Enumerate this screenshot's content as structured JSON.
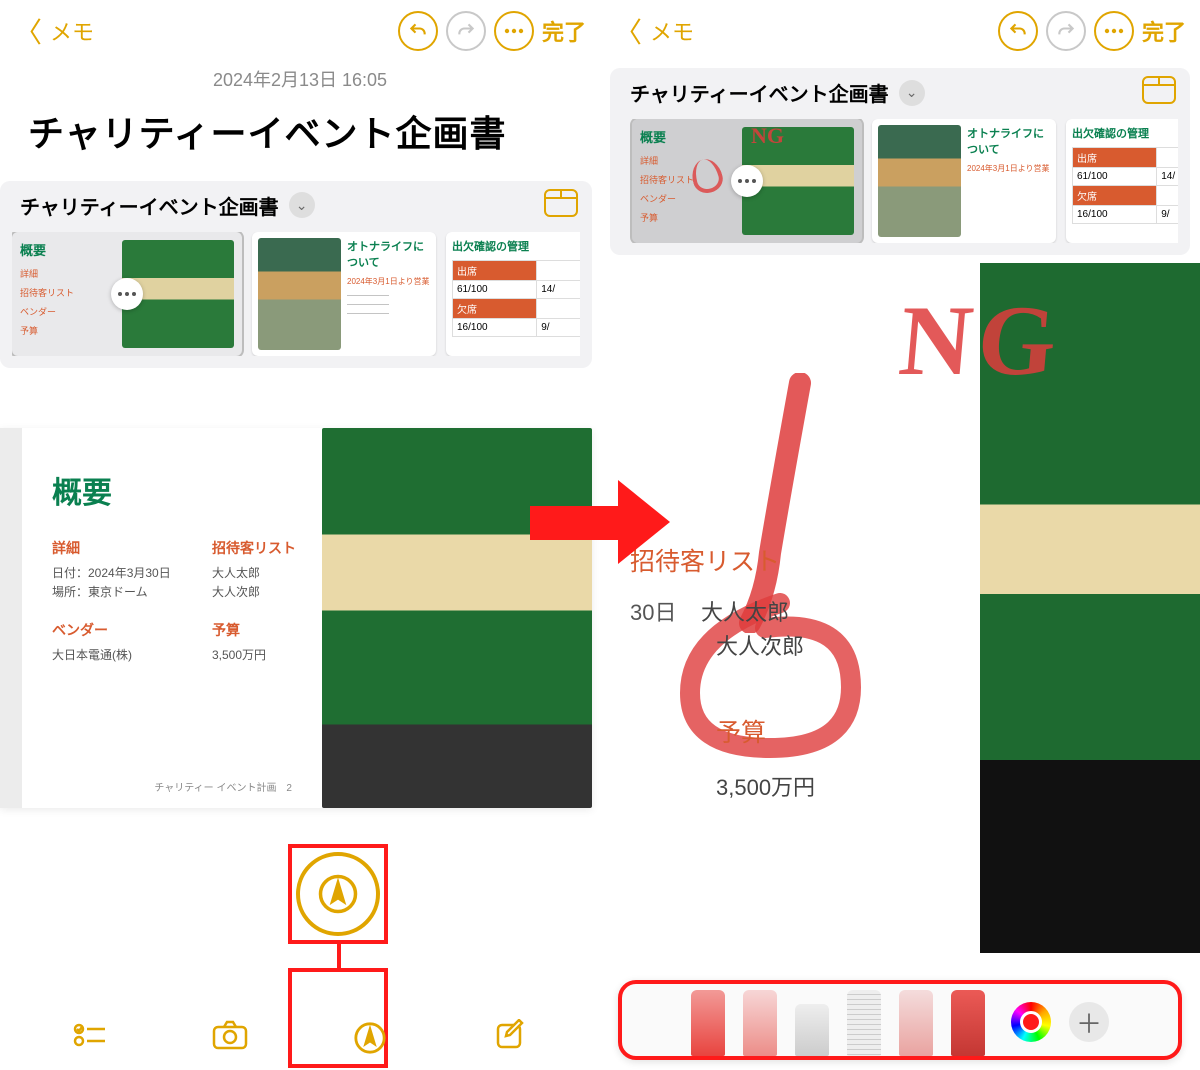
{
  "header": {
    "back_label": "メモ",
    "done_label": "完了"
  },
  "datetime": "2024年2月13日 16:05",
  "title": "チャリティーイベント企画書",
  "attachment": {
    "title": "チャリティーイベント企画書",
    "thumb1_heading": "概要",
    "thumb2_heading": "オトナライフについて",
    "thumb3_heading": "出欠確認の管理",
    "table_v1": "61/100",
    "table_v2": "14/",
    "table_v3": "16/100",
    "table_v4": "9/"
  },
  "slide": {
    "heading": "概要",
    "detail_label": "詳細",
    "detail_date": "日付：2024年3月30日",
    "detail_place": "場所：東京ドーム",
    "guests_label": "招待客リスト",
    "guest1": "大人太郎",
    "guest2": "大人次郎",
    "vendor_label": "ベンダー",
    "vendor_value": "大日本電通(株)",
    "budget_label": "予算",
    "budget_value": "3,500万円",
    "footer": "チャリティー イベント計画　2"
  },
  "zoom": {
    "date_frag": "30日",
    "guests_label": "招待客リスト",
    "guest1": "大人太郎",
    "guest2": "大人次郎",
    "budget_label": "予算",
    "budget_value": "3,500万円",
    "annotation_text": "NG"
  },
  "tools": {
    "pen": "pen",
    "marker": "marker",
    "eraser": "eraser",
    "ruler": "ruler",
    "pencil": "pencil",
    "crayon": "crayon"
  }
}
